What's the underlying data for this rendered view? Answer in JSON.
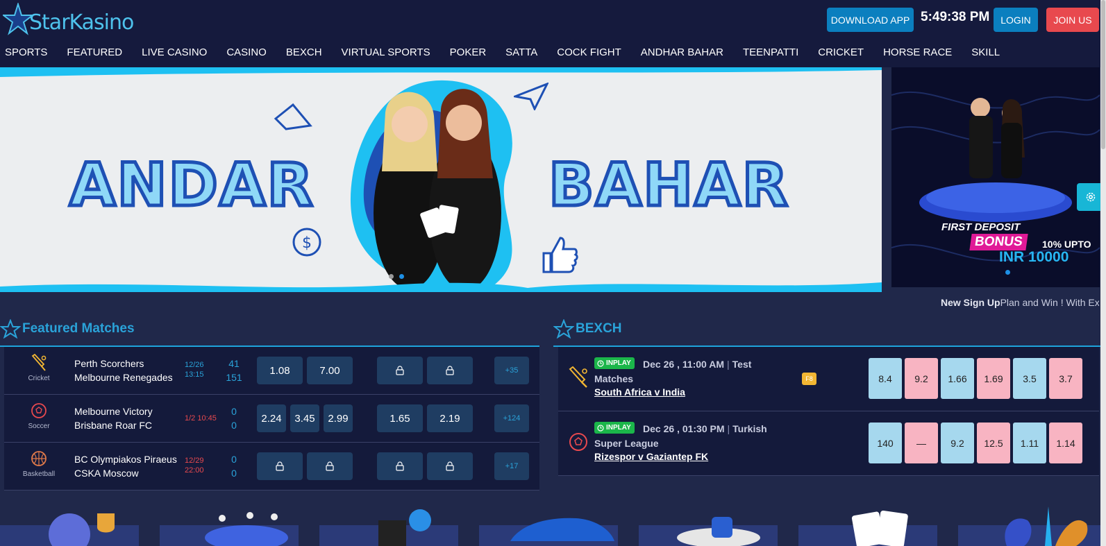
{
  "brand": {
    "logo_text": "StarKasino"
  },
  "header": {
    "download_label": "DOWNLOAD APP",
    "clock": "5:49:38 PM",
    "login_label": "LOGIN",
    "join_label": "JOIN US"
  },
  "nav": [
    "SPORTS",
    "FEATURED",
    "LIVE CASINO",
    "CASINO",
    "BEXCH",
    "VIRTUAL SPORTS",
    "POKER",
    "SATTA",
    "COCK FIGHT",
    "ANDHAR BAHAR",
    "TEENPATTI",
    "CRICKET",
    "HORSE RACE",
    "SKILL"
  ],
  "banner": {
    "word_left": "ANDAR",
    "word_right": "BAHAR"
  },
  "promo": {
    "title": "FIRST DEPOSIT",
    "bonus": "BONUS",
    "upto": "10% UPTO",
    "amount": "INR 10000"
  },
  "marquee": {
    "bold": "New Sign Up",
    "text": "Plan and Win ! With Ex"
  },
  "featured": {
    "title": "Featured Matches",
    "rows": [
      {
        "sport": "Cricket",
        "team1": "Perth Scorchers",
        "team2": "Melbourne Renegades",
        "date1": "12/26",
        "date2": "13:15",
        "date_color": "blue",
        "score1": "41",
        "score2": "151",
        "odds": [
          "1.08",
          "7.00"
        ],
        "locked": [
          "lock",
          "lock"
        ],
        "more": "+35"
      },
      {
        "sport": "Soccer",
        "team1": "Melbourne Victory",
        "team2": "Brisbane Roar FC",
        "date1": "1/2 10:45",
        "date2": "",
        "date_color": "red",
        "score1": "0",
        "score2": "0",
        "odds3": [
          "2.24",
          "3.45",
          "2.99"
        ],
        "odds2": [
          "1.65",
          "2.19"
        ],
        "more": "+124"
      },
      {
        "sport": "Basketball",
        "team1": "BC Olympiakos Piraeus",
        "team2": "CSKA Moscow",
        "date1": "12/29",
        "date2": "22:00",
        "date_color": "red",
        "score1": "0",
        "score2": "0",
        "more": "+17"
      }
    ]
  },
  "bexch": {
    "title": "BEXCH",
    "rows": [
      {
        "badge": "INPLAY",
        "datetime": "Dec 26 , 11:00 AM",
        "competition": "Test Matches",
        "match": "South Africa v India",
        "fancy": "F8",
        "odds": [
          "8.4",
          "9.2",
          "1.66",
          "1.69",
          "3.5",
          "3.7"
        ]
      },
      {
        "badge": "INPLAY",
        "datetime": "Dec 26 , 01:30 PM",
        "competition": "Turkish Super League",
        "match": "Rizespor v Gaziantep FK",
        "odds": [
          "140",
          "—",
          "9.2",
          "12.5",
          "1.11",
          "1.14"
        ]
      }
    ]
  },
  "colors": {
    "bg": "#20284a",
    "header": "#151a3d",
    "accent": "#1ea4dc",
    "join": "#e8494e",
    "back": "#a6d8ee",
    "lay": "#f8b4c2"
  }
}
